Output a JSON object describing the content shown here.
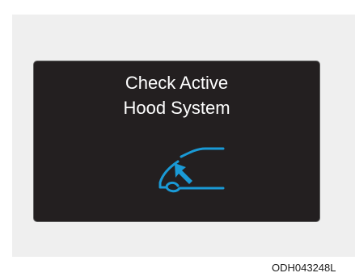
{
  "display": {
    "message_line1": "Check Active",
    "message_line2": "Hood System",
    "icon": "active-hood-warning-icon",
    "icon_color": "#1a9ad6",
    "panel_color": "#231f20",
    "text_color": "#ffffff"
  },
  "footer": {
    "image_code": "ODH043248L"
  }
}
